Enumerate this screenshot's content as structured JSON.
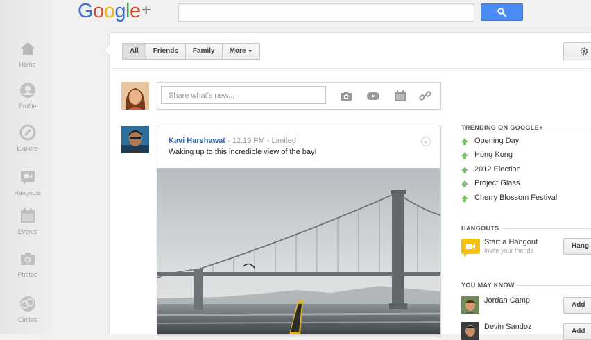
{
  "header": {
    "logo_letters": [
      {
        "ch": "G",
        "color": "#3b6fd7"
      },
      {
        "ch": "o",
        "color": "#d64631"
      },
      {
        "ch": "o",
        "color": "#f3b214"
      },
      {
        "ch": "g",
        "color": "#3b6fd7"
      },
      {
        "ch": "l",
        "color": "#3fa353"
      },
      {
        "ch": "e",
        "color": "#d64631"
      },
      {
        "ch": "+",
        "color": "#555555"
      }
    ],
    "search_placeholder": ""
  },
  "nav": {
    "items": [
      {
        "label": "Home",
        "icon": "home-icon"
      },
      {
        "label": "Profile",
        "icon": "profile-icon"
      },
      {
        "label": "Explore",
        "icon": "explore-icon"
      },
      {
        "label": "Hangouts",
        "icon": "hangouts-icon"
      },
      {
        "label": "Events",
        "icon": "events-icon"
      },
      {
        "label": "Photos",
        "icon": "photos-icon"
      },
      {
        "label": "Circles",
        "icon": "circles-icon"
      }
    ]
  },
  "filters": [
    "All",
    "Friends",
    "Family",
    "More"
  ],
  "share": {
    "placeholder": "Share what's new..."
  },
  "post": {
    "author": "Kavi Harshawat",
    "meta": " - 12:19 PM - Limited",
    "text": "Waking up to this incredible view of the bay!"
  },
  "trending": {
    "title": "TRENDING ON GOOGLE+",
    "items": [
      "Opening Day",
      "Hong Kong",
      "2012 Election",
      "Project Glass",
      "Cherry Blossom Festival"
    ]
  },
  "hangouts": {
    "title": "HANGOUTS",
    "start": "Start a Hangout",
    "sub": "Invite your friends",
    "button": "Hang o"
  },
  "you_may_know": {
    "title": "YOU MAY KNOW",
    "people": [
      {
        "name": "Jordan Camp",
        "button": "Add"
      },
      {
        "name": "Devin Sandoz",
        "button": "Add"
      }
    ]
  },
  "colors": {
    "accent": "#4a8af4",
    "link": "#3366aa",
    "trend_arrow": "#7fc26f",
    "hangout": "#f4c20d"
  }
}
